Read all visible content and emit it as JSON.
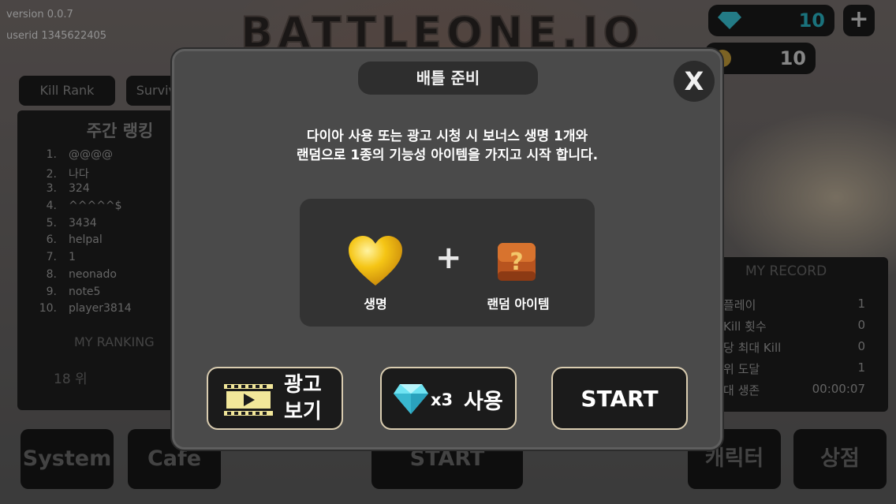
{
  "app": {
    "version": "version 0.0.7",
    "userid": "userid 1345622405",
    "logo_text": "BATTLEONE.IO"
  },
  "tabs": {
    "kill_rank": "Kill Rank",
    "survival": "Survival"
  },
  "ranking": {
    "title": "주간 랭킹",
    "entries": [
      {
        "rank": "1.",
        "name": "@@@@"
      },
      {
        "rank": "2.",
        "name": "나다"
      },
      {
        "rank": "3.",
        "name": "324"
      },
      {
        "rank": "4.",
        "name": "^^^^^$"
      },
      {
        "rank": "5.",
        "name": "3434"
      },
      {
        "rank": "6.",
        "name": "helpal"
      },
      {
        "rank": "7.",
        "name": "1"
      },
      {
        "rank": "8.",
        "name": "neonado"
      },
      {
        "rank": "9.",
        "name": "note5"
      },
      {
        "rank": "10.",
        "name": "player3814"
      }
    ],
    "my_ranking_title": "MY RANKING",
    "my_ranking_value": "18 위"
  },
  "currency": {
    "diamond": "10",
    "coin": "10",
    "diamond_color": "#2ab8c9",
    "coin_color": "#d8d8d8"
  },
  "record": {
    "title": "MY RECORD",
    "rows": [
      {
        "label": "플레이",
        "value": "1"
      },
      {
        "label": "Kill 횟수",
        "value": "0"
      },
      {
        "label": "당 최대 Kill",
        "value": "0"
      },
      {
        "label": "위 도달",
        "value": "1"
      },
      {
        "label": "대 생존",
        "value": "00:00:07"
      }
    ]
  },
  "bottom": {
    "system": "System",
    "cafe": "Cafe",
    "start": "START",
    "character": "캐릭터",
    "shop": "상점"
  },
  "modal": {
    "title": "배틀 준비",
    "close": "X",
    "desc_line1": "다이아 사용 또는 광고 시청 시 보너스 생명 1개와",
    "desc_line2": "랜덤으로 1종의 기능성 아이템을 가지고 시작 합니다.",
    "reward_life": "생명",
    "reward_plus": "+",
    "reward_item": "랜덤 아이템",
    "ad_line1": "광고",
    "ad_line2": "보기",
    "diamond_count": "x3",
    "use_label": "사용",
    "start_label": "START",
    "icons": [
      "heart-icon",
      "mystery-box-icon",
      "film-icon",
      "diamond-icon"
    ]
  }
}
